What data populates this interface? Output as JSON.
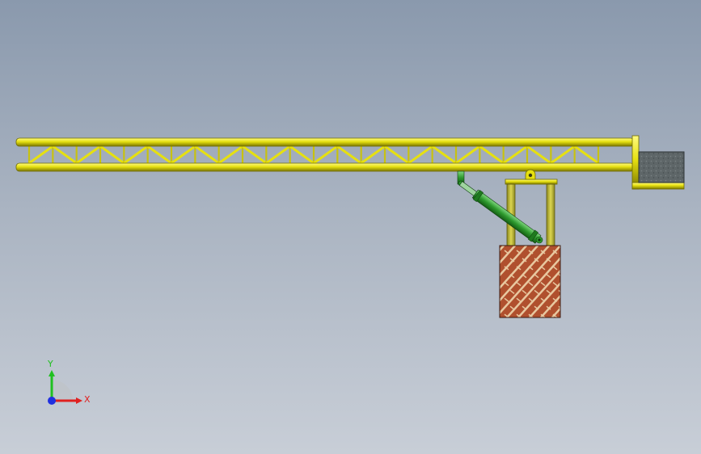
{
  "triad": {
    "x_label": "X",
    "y_label": "Y"
  },
  "colors": {
    "truss": "#e6e010",
    "truss_dark": "#8a8600",
    "post": "#c9c436",
    "cylinder": "#3aa63a",
    "brick": "#b0502e",
    "counterweight": "#5c6466",
    "x_axis": "#e02020",
    "y_axis": "#20c020",
    "z_axis": "#2030e0"
  },
  "scene": {
    "truss_panels": 24,
    "brick_rows": 9
  }
}
